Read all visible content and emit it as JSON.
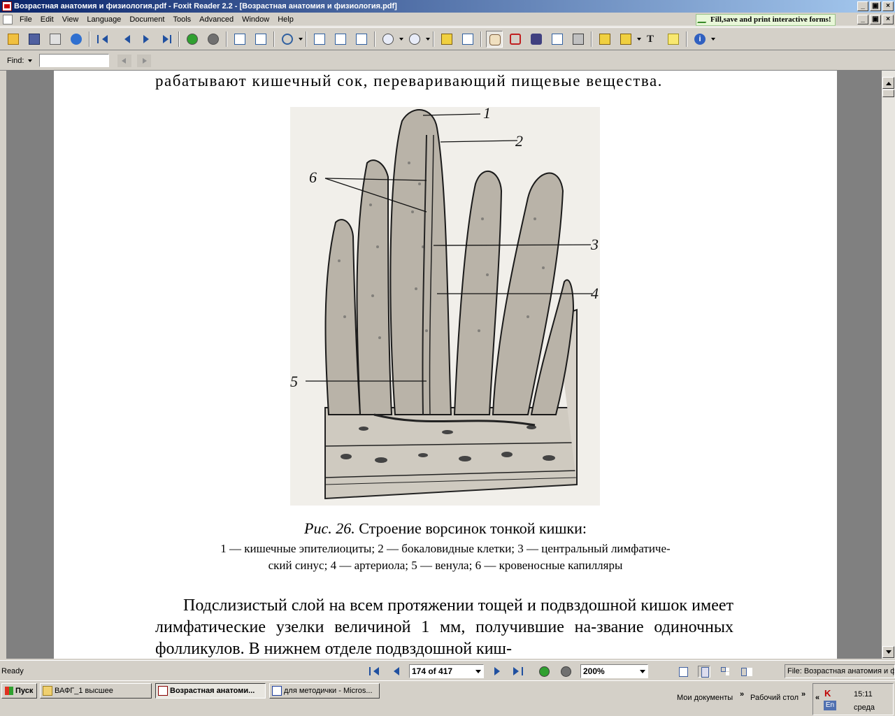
{
  "window": {
    "title": "Возрастная анатомия и физиология.pdf - Foxit Reader 2.2 - [Возрастная анатомия и физиология.pdf]",
    "min": "_",
    "max": "□",
    "close": "×",
    "mdi_restore": "▣"
  },
  "menu": [
    "File",
    "Edit",
    "View",
    "Language",
    "Document",
    "Tools",
    "Advanced",
    "Window",
    "Help"
  ],
  "fill_save_banner": "Fill,save and print interactive forms!",
  "toolbar_icons": [
    "open-icon",
    "save-icon",
    "print-icon",
    "globe-icon",
    "first-page-icon",
    "prev-page-icon",
    "next-page-icon",
    "last-page-icon",
    "back-icon",
    "forward-icon",
    "extract-icon",
    "rotate-icon",
    "zoom-icon",
    "page-icon",
    "fit-width-icon",
    "fit-page-icon",
    "zoom-out-icon",
    "zoom-in-icon",
    "bookmark-icon",
    "thumbnail-icon",
    "hand-icon",
    "select-text-icon",
    "find-icon",
    "typewriter-icon",
    "snapshot-icon",
    "highlight-icon",
    "pen-icon",
    "text-icon",
    "note-icon",
    "info-icon"
  ],
  "find": {
    "label": "Find:",
    "value": ""
  },
  "document": {
    "top_line": "рабатывают кишечный сок, переваривающий пищевые вещества.",
    "figure_labels": [
      "1",
      "2",
      "6",
      "3",
      "4",
      "5"
    ],
    "caption_fig": "Рис. 26.",
    "caption_title": "Строение ворсинок тонкой кишки:",
    "caption_items": [
      {
        "n": "1",
        "t": "— кишечные эпителиоциты;"
      },
      {
        "n": "2",
        "t": "— бокаловидные клетки;"
      },
      {
        "n": "3",
        "t": "— центральный лимфатиче-ский синус;"
      },
      {
        "n": "4",
        "t": "— артериола;"
      },
      {
        "n": "5",
        "t": "— венула;"
      },
      {
        "n": "6",
        "t": "— кровеносные капилляры"
      }
    ],
    "caption_line1": "1 — кишечные эпителиоциты; 2 — бокаловидные клетки; 3 — центральный лимфатиче-",
    "caption_line2": "ский синус; 4 — артериола; 5 — венула; 6 — кровеносные капилляры",
    "body": "Подслизистый слой на всем протяжении тощей и подвздошной кишок имеет лимфатические узелки величиной 1 мм, получившие на-звание одиночных фолликулов. В нижнем отделе подвздошной киш-"
  },
  "status": {
    "ready": "Ready",
    "page": "174 of 417",
    "zoom": "200%",
    "file": "File: Возрастная анатомия и физиология.pdf"
  },
  "taskbar": {
    "start": "Пуск",
    "tasks": [
      "ВАФГ_1 высшее",
      "Возрастная анатоми...",
      "для методички - Micros..."
    ],
    "quick_links": [
      "Мои документы",
      "Рабочий стол"
    ],
    "chevrons": [
      "»",
      "»",
      "«"
    ],
    "tray_antivirus": "K",
    "tray_lang": "En",
    "time": "15:11",
    "day": "среда"
  }
}
